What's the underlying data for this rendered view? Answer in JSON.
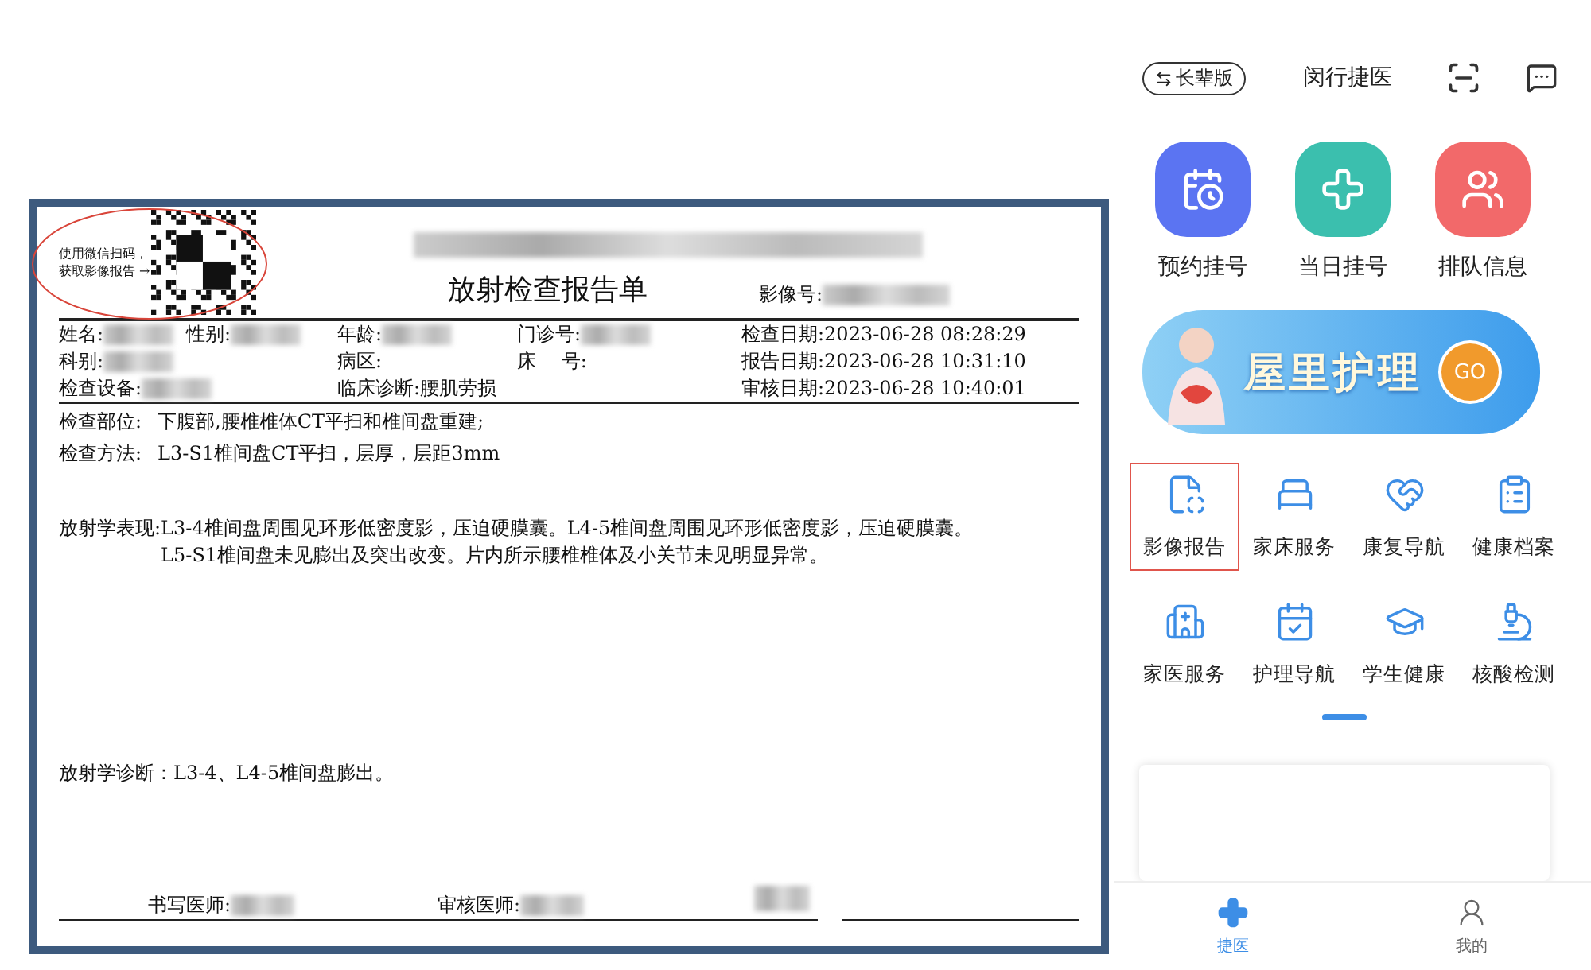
{
  "report": {
    "qr_caption": "使用微信扫码，获取影像报告 →",
    "title": "放射检查报告单",
    "image_no_label": "影像号:",
    "info_rows": [
      {
        "cells": [
          {
            "fields": [
              {
                "label": "姓名:",
                "redacted": true
              },
              {
                "label": "性别:",
                "redacted": true
              }
            ]
          },
          {
            "fields": [
              {
                "label": "年龄:",
                "redacted": true
              }
            ]
          },
          {
            "fields": [
              {
                "label": "门诊号:",
                "redacted": true
              }
            ]
          },
          {
            "fields": [
              {
                "label": "检查日期:2023-06-28  08:28:29",
                "redacted": false
              }
            ]
          }
        ]
      },
      {
        "cells": [
          {
            "fields": [
              {
                "label": "科别:",
                "redacted": true
              }
            ]
          },
          {
            "fields": [
              {
                "label": "病区:",
                "redacted": false
              }
            ]
          },
          {
            "fields": [
              {
                "label": "床　 号:",
                "redacted": false
              }
            ]
          },
          {
            "fields": [
              {
                "label": "报告日期:2023-06-28  10:31:10",
                "redacted": false
              }
            ]
          }
        ]
      },
      {
        "cells": [
          {
            "fields": [
              {
                "label": "检查设备:",
                "redacted": true
              }
            ]
          },
          {
            "fields": [
              {
                "label": "临床诊断:腰肌劳损",
                "redacted": false
              }
            ]
          },
          {
            "fields": [
              {
                "label": "审核日期:2023-06-28  10:40:01",
                "redacted": false
              }
            ]
          }
        ]
      }
    ],
    "exam_lines": [
      {
        "label": "检查部位:",
        "value": "下腹部,腰椎椎体CT平扫和椎间盘重建;"
      },
      {
        "label": "检查方法:",
        "value": "L3-S1椎间盘CT平扫，层厚，层距3mm"
      }
    ],
    "findings": {
      "label": "放射学表现:",
      "value": "L3-4椎间盘周围见环形低密度影，压迫硬膜囊。L4-5椎间盘周围见环形低密度影，压迫硬膜囊。L5-S1椎间盘未见膨出及突出改变。片内所示腰椎椎体及小关节未见明显异常。"
    },
    "diagnosis": "放射学诊断：L3-4、L4-5椎间盘膨出。",
    "signatures": [
      {
        "label": "书写医师:",
        "redacted": true
      },
      {
        "label": "审核医师:",
        "redacted": true
      }
    ]
  },
  "app": {
    "mode_button": "长辈版",
    "title": "闵行捷医",
    "quick_tiles": [
      {
        "label": "预约挂号",
        "color": "#5b74f2"
      },
      {
        "label": "当日挂号",
        "color": "#3bbfae"
      },
      {
        "label": "排队信息",
        "color": "#f2696a"
      }
    ],
    "banner": {
      "text": "屋里护理",
      "button": "GO"
    },
    "services": [
      {
        "label": "影像报告",
        "selected": true
      },
      {
        "label": "家床服务",
        "selected": false
      },
      {
        "label": "康复导航",
        "selected": false
      },
      {
        "label": "健康档案",
        "selected": false
      },
      {
        "label": "家医服务",
        "selected": false
      },
      {
        "label": "护理导航",
        "selected": false
      },
      {
        "label": "学生健康",
        "selected": false
      },
      {
        "label": "核酸检测",
        "selected": false
      }
    ],
    "nav": [
      {
        "label": "捷医",
        "selected": true
      },
      {
        "label": "我的",
        "selected": false
      }
    ]
  }
}
